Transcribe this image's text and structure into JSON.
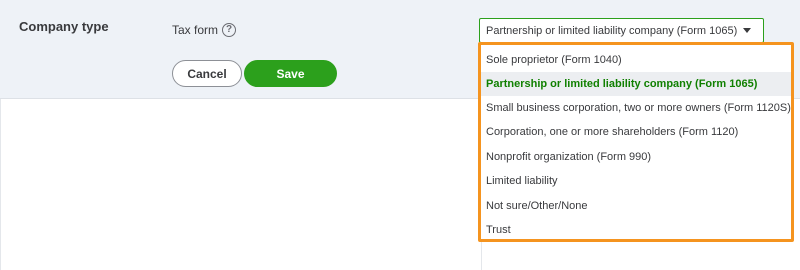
{
  "section": {
    "label": "Company type"
  },
  "tax_form": {
    "label": "Tax form",
    "help_icon_glyph": "?",
    "selected_value": "Partnership or limited liability company (Form 1065)",
    "options": [
      "Sole proprietor (Form 1040)",
      "Partnership or limited liability company (Form 1065)",
      "Small business corporation, two or more owners (Form 1120S)",
      "Corporation, one or more shareholders (Form 1120)",
      "Nonprofit organization (Form 990)",
      "Limited liability",
      "Not sure/Other/None",
      "Trust"
    ],
    "selected_index": 1
  },
  "actions": {
    "cancel_label": "Cancel",
    "save_label": "Save"
  },
  "icons": {
    "help": "question-circle-icon",
    "caret": "caret-down-icon"
  },
  "colors": {
    "accent_green": "#2ca01c",
    "selected_text_green": "#108000",
    "highlight_orange": "#f5941f",
    "panel_bg": "#eef2f7"
  }
}
